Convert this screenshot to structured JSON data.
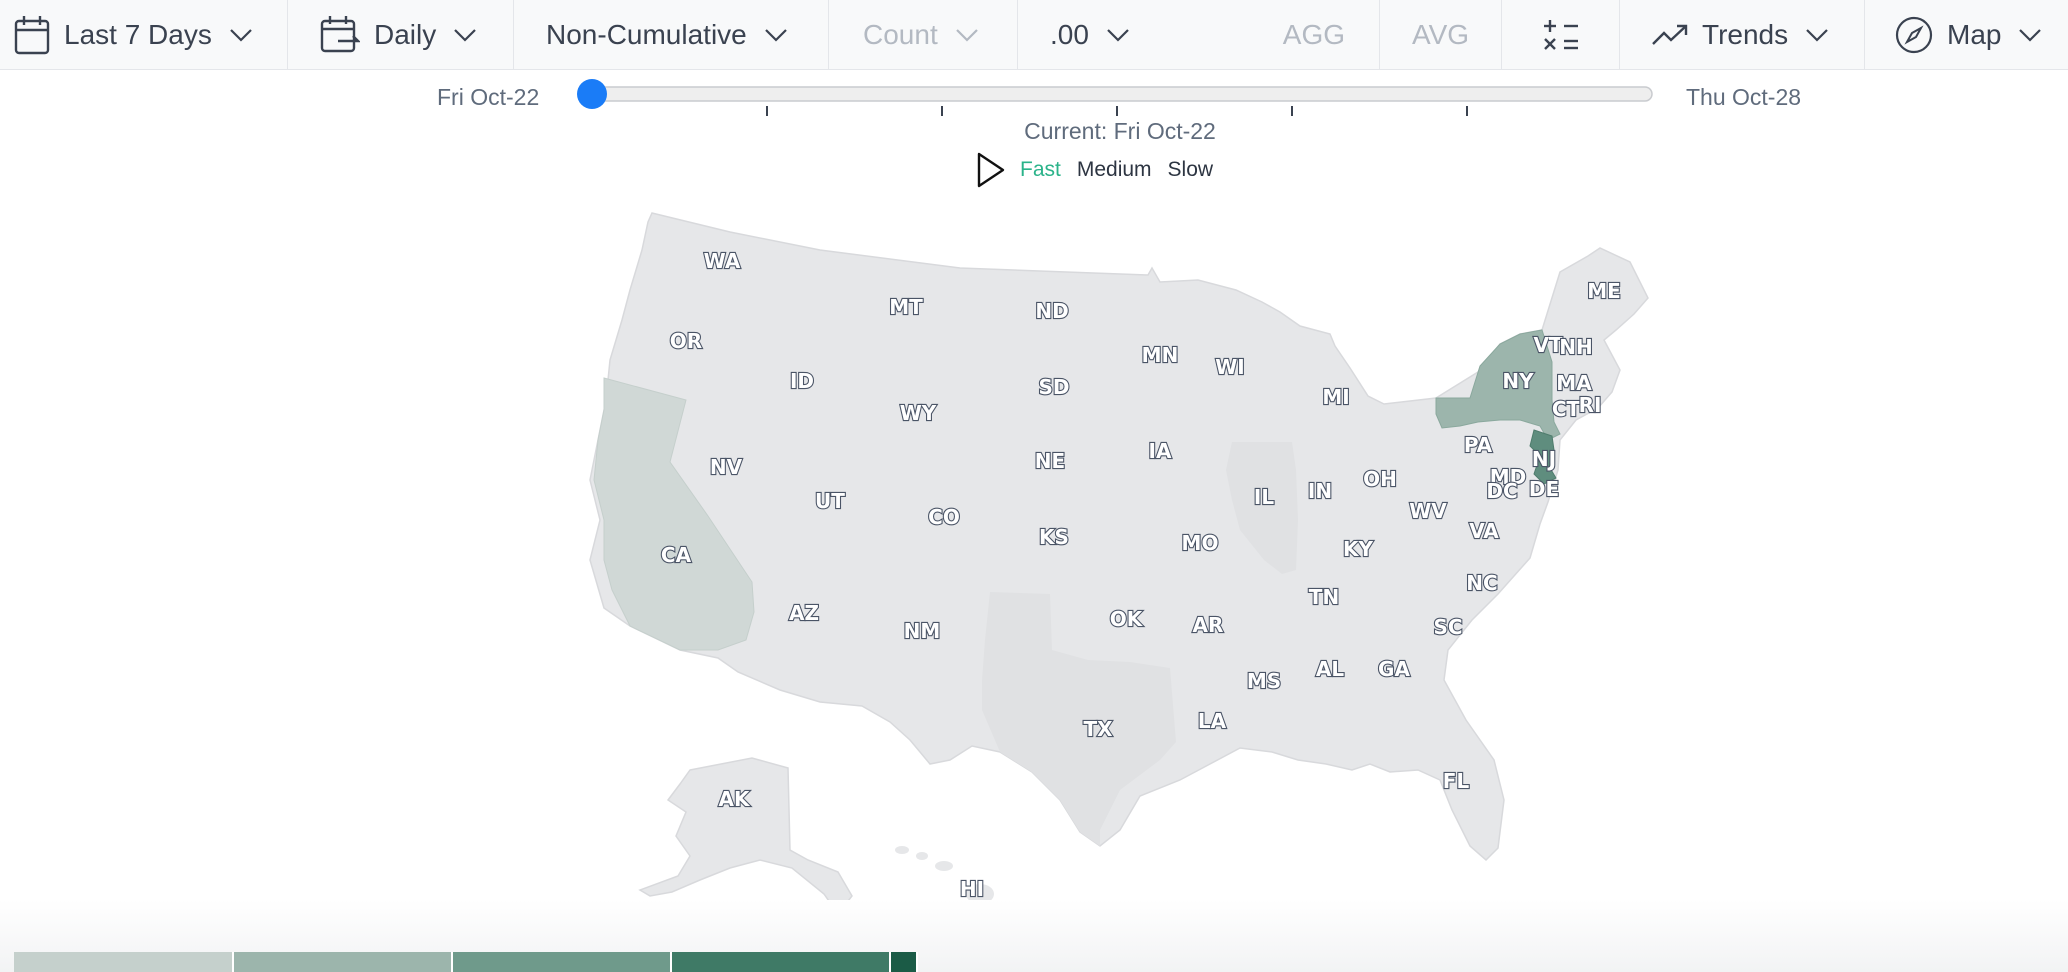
{
  "toolbar": {
    "date_range": "Last 7 Days",
    "interval": "Daily",
    "cumulative": "Non-Cumulative",
    "metric": "Count",
    "precision": ".00",
    "agg": "AGG",
    "avg": "AVG",
    "trends": "Trends",
    "map": "Map"
  },
  "timeline": {
    "start_label": "Fri Oct-22",
    "end_label": "Thu Oct-28",
    "current_label": "Current: Fri Oct-22",
    "position_fraction": 0,
    "ticks": 7
  },
  "playback": {
    "speeds": [
      "Fast",
      "Medium",
      "Slow"
    ],
    "selected": "Fast"
  },
  "map": {
    "states": [
      "WA",
      "OR",
      "CA",
      "NV",
      "ID",
      "MT",
      "WY",
      "UT",
      "AZ",
      "CO",
      "NM",
      "ND",
      "SD",
      "NE",
      "KS",
      "OK",
      "TX",
      "MN",
      "IA",
      "MO",
      "AR",
      "LA",
      "WI",
      "IL",
      "MI",
      "IN",
      "OH",
      "KY",
      "TN",
      "MS",
      "AL",
      "GA",
      "FL",
      "SC",
      "NC",
      "VA",
      "WV",
      "PA",
      "NY",
      "VT",
      "NH",
      "ME",
      "MA",
      "CT",
      "RI",
      "NJ",
      "DE",
      "MD",
      "DC",
      "AK",
      "HI"
    ],
    "highlighted": [
      {
        "state": "CA",
        "level": 1
      },
      {
        "state": "NY",
        "level": 2
      },
      {
        "state": "NJ",
        "level": 3
      }
    ]
  },
  "colors": {
    "base": "#e6e7e9",
    "level1": "#d0d8d6",
    "level2": "#9cb5ac",
    "level3": "#5f8d7e",
    "accent": "#1a7cf7",
    "active_speed": "#2bb38a"
  },
  "legend_colors": [
    "#c5d0cc",
    "#9cb5ac",
    "#6f9a8b",
    "#3f7a66",
    "#1b5b46"
  ]
}
